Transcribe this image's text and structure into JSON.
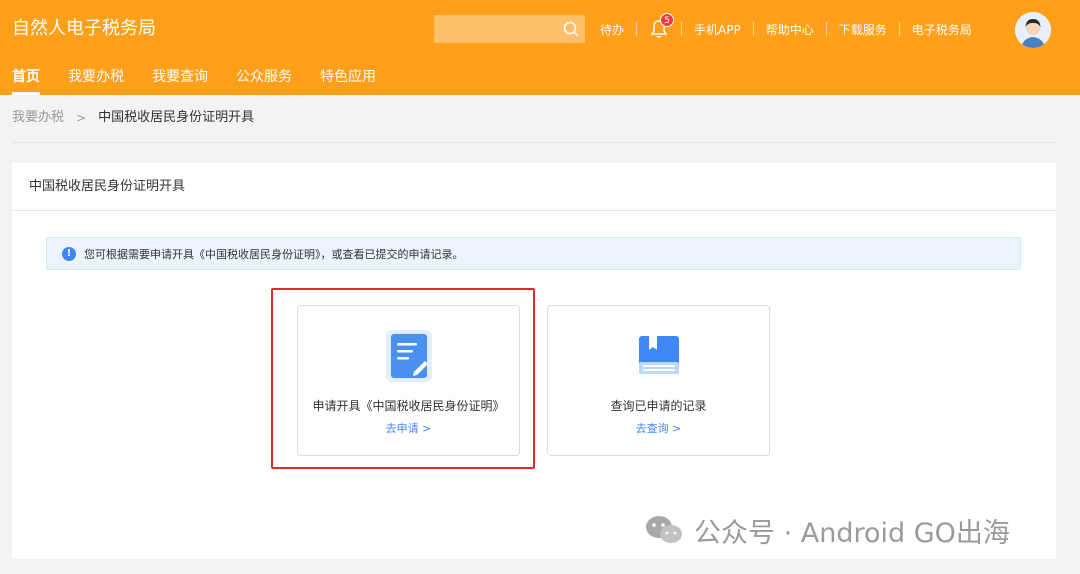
{
  "header": {
    "app_title": "自然人电子税务局",
    "search_placeholder": "",
    "links": [
      "待办",
      "手机APP",
      "帮助中心",
      "下载服务",
      "电子税务局"
    ],
    "notification_count": "5",
    "brand_color": "#ff9f1a"
  },
  "nav": {
    "items": [
      "首页",
      "我要办税",
      "我要查询",
      "公众服务",
      "特色应用"
    ],
    "active": "首页"
  },
  "breadcrumb": {
    "parent": "我要办税",
    "separator": ">",
    "current": "中国税收居民身份证明开具"
  },
  "panel": {
    "title": "中国税收居民身份证明开具",
    "notice": "您可根据需要申请开具《中国税收居民身份证明》，或查看已提交的申请记录。",
    "cards": [
      {
        "icon": "document-edit-icon",
        "title": "申请开具《中国税收居民身份证明》",
        "link": "去申请 >"
      },
      {
        "icon": "bookmark-book-icon",
        "title": "查询已申请的记录",
        "link": "去查询 >"
      }
    ]
  },
  "watermark": {
    "text": "公众号 · Android GO出海"
  },
  "colors": {
    "link_blue": "#3f87f5",
    "highlight_red": "#e02b2b"
  }
}
